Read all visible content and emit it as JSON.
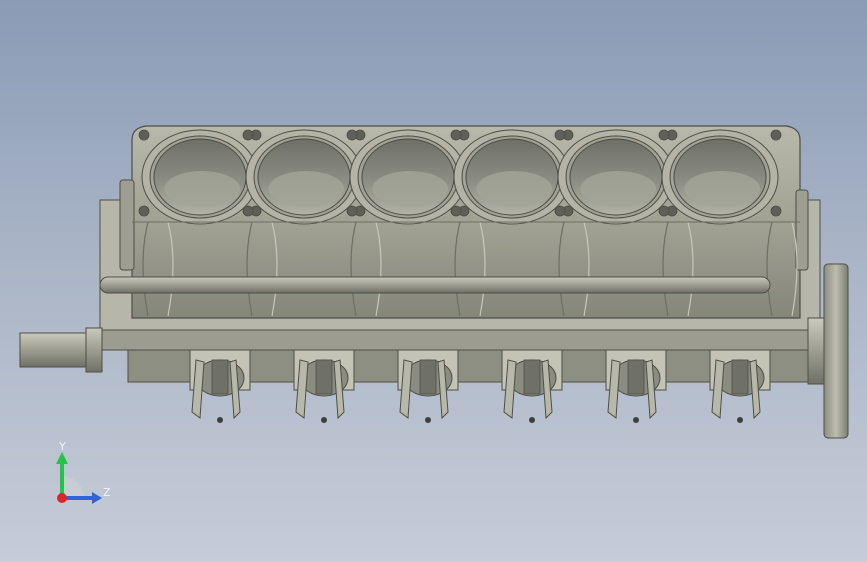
{
  "viewport": {
    "background_top": "#8a9bb6",
    "background_bottom": "#c6ccd8"
  },
  "model": {
    "part": "engine-block-inline-6",
    "cylinder_count": 6,
    "crank_throw_count": 6,
    "metal_color": "#a7a89a",
    "dark_metal_color": "#6f7066"
  },
  "triad": {
    "y_label": "Y",
    "z_label": "Z",
    "y_color": "#27c24a",
    "z_color": "#2f63d9",
    "x_color": "#d9262b"
  }
}
